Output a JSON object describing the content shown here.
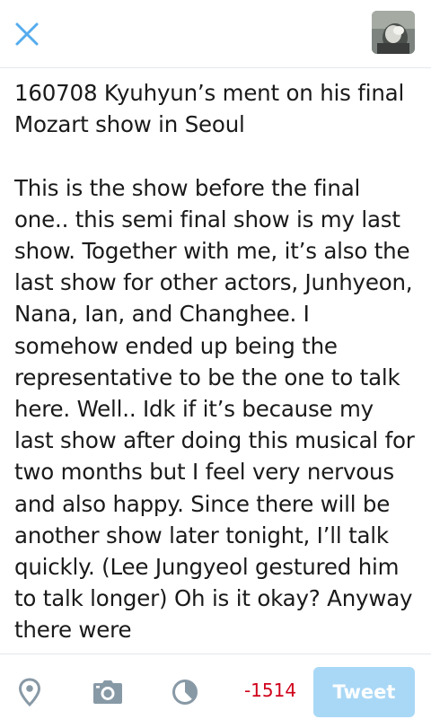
{
  "header": {
    "close_icon": "close-icon",
    "avatar_alt": "profile-avatar"
  },
  "composer": {
    "text": "160708 Kyuhyun’s ment on his final Mozart show in Seoul\n\nThis is the show before the final one.. this semi final show is my last show. Together with me, it’s also the last show for other actors, Junhyeon, Nana, Ian, and Changhee. I somehow ended up being the representative to be the one to talk here. Well.. Idk if it’s because my last show after doing this musical for two months but I feel very nervous and also happy. Since there will be another show later tonight, I’ll talk quickly. (Lee Jungyeol gestured him to talk longer) Oh is it okay? Anyway there were"
  },
  "toolbar": {
    "location_icon": "location-pin-icon",
    "camera_icon": "camera-icon",
    "timer_icon": "pie-timer-icon",
    "char_count": "-1514",
    "tweet_label": "Tweet"
  },
  "colors": {
    "accent": "#55acee",
    "icon_gray": "#8899a6",
    "counter_red": "#d0021b",
    "tweet_button_disabled": "#a9d8f6",
    "divider": "#e1e8ed"
  }
}
